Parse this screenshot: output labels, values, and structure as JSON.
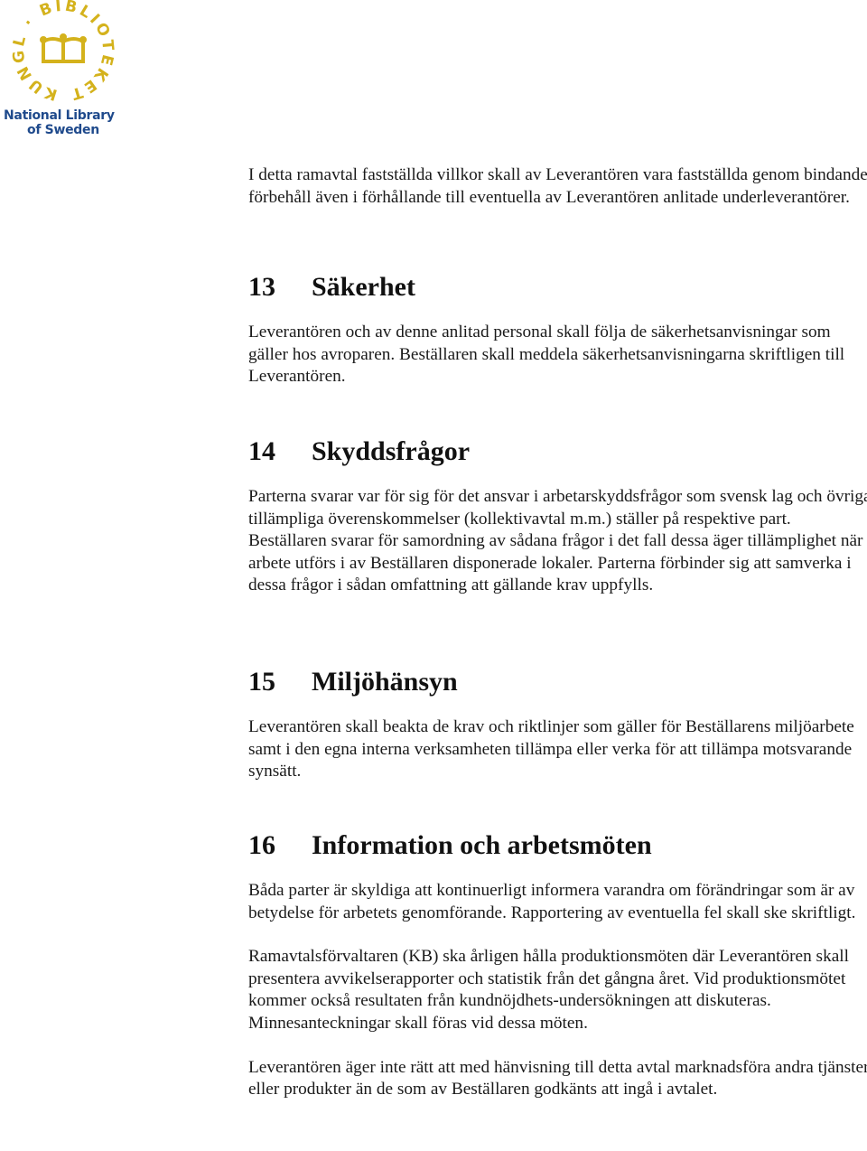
{
  "logo": {
    "ring_text": "KUNGL · BIBLIOTEKET ·",
    "name_line1": "National Library",
    "name_line2": "of Sweden",
    "colors": {
      "emblem": "#d4b21c",
      "name": "#1f4a8c"
    }
  },
  "intro": "I detta ramavtal fastställda villkor skall av Leverantören vara fastställda genom bindande förbehåll även i förhållande till eventuella av Leverantören anlitade underleverantörer.",
  "sections": [
    {
      "number": "13",
      "title": "Säkerhet",
      "paragraphs": [
        "Leverantören och av denne anlitad personal skall följa de säkerhetsanvisningar som gäller hos avroparen. Beställaren skall meddela säkerhetsanvisningarna skriftligen till Leverantören."
      ]
    },
    {
      "number": "14",
      "title": "Skyddsfrågor",
      "paragraphs": [
        "Parterna svarar var för sig för det ansvar i arbetarskyddsfrågor som svensk lag och övriga tillämpliga överenskommelser (kollektivavtal m.m.) ställer på respektive part. Beställaren svarar för samordning av sådana frågor i det fall dessa äger tillämplighet när arbete utförs i av Beställaren disponerade lokaler. Parterna förbinder sig att samverka i dessa frågor i sådan omfattning att gällande krav uppfylls."
      ]
    },
    {
      "number": "15",
      "title": "Miljöhänsyn",
      "paragraphs": [
        "Leverantören skall beakta de krav och riktlinjer som gäller för Beställarens miljöarbete samt i den egna interna verksamheten tillämpa eller verka för att tillämpa motsvarande synsätt."
      ]
    },
    {
      "number": "16",
      "title": "Information och arbetsmöten",
      "paragraphs": [
        "Båda parter är skyldiga att kontinuerligt informera varandra om förändringar som är av betydelse för arbetets genomförande. Rapportering av eventuella fel skall ske skriftligt.",
        "Ramavtalsförvaltaren (KB) ska årligen hålla produktionsmöten där Leverantören skall presentera avvikelserapporter och statistik från det gångna året. Vid produktionsmötet kommer också resultaten från kundnöjdhets-undersökningen att diskuteras. Minnesanteckningar skall föras vid dessa möten.",
        "Leverantören äger inte rätt att med hänvisning till detta avtal marknadsföra andra tjänster eller produkter än de som av Beställaren godkänts att ingå i avtalet."
      ]
    }
  ]
}
